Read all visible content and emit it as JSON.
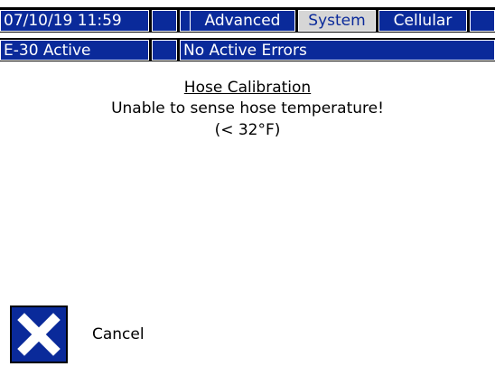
{
  "status": {
    "datetime": "07/10/19 11:59",
    "tabs": [
      {
        "label": "Advanced",
        "selected": false
      },
      {
        "label": "System",
        "selected": true
      },
      {
        "label": "Cellular",
        "selected": false
      }
    ],
    "active_event": "E-30 Active",
    "errors": "No Active Errors"
  },
  "message": {
    "title": "Hose Calibration",
    "line1": "Unable to sense hose temperature!",
    "line2": "(< 32°F)"
  },
  "action": {
    "cancel_label": "Cancel",
    "cancel_icon": "x-icon"
  },
  "colors": {
    "bar_blue": "#0a2a9a",
    "selected_tab": "#d6d6d6"
  }
}
